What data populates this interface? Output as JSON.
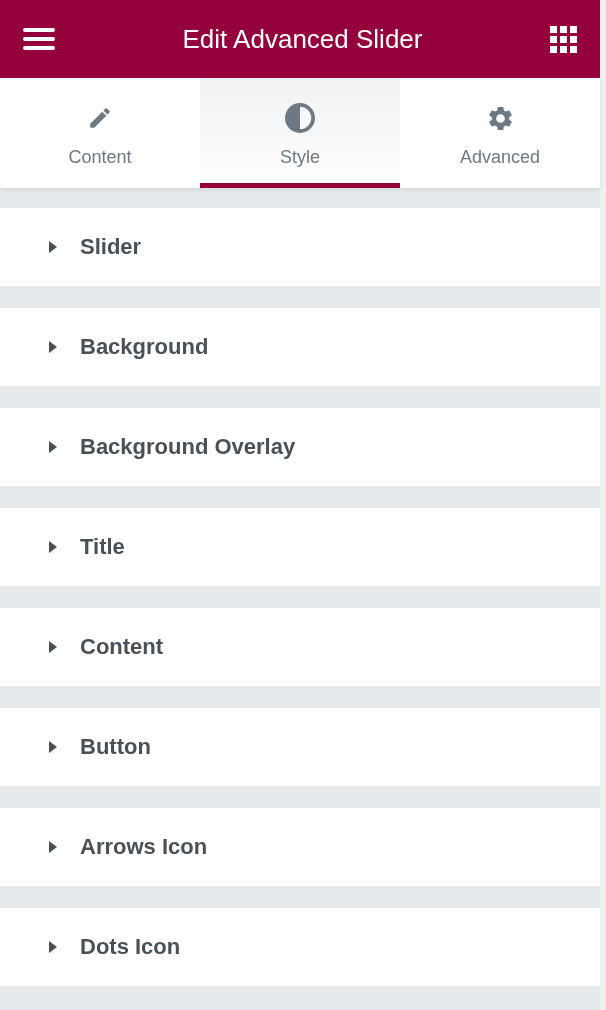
{
  "header": {
    "title": "Edit Advanced Slider"
  },
  "tabs": [
    {
      "label": "Content",
      "kind": "pencil",
      "selected": false
    },
    {
      "label": "Style",
      "kind": "contrast",
      "selected": true
    },
    {
      "label": "Advanced",
      "kind": "gear",
      "selected": false
    }
  ],
  "sections": [
    {
      "title": "Slider",
      "expanded": false
    },
    {
      "title": "Background",
      "expanded": false
    },
    {
      "title": "Background Overlay",
      "expanded": false
    },
    {
      "title": "Title",
      "expanded": false
    },
    {
      "title": "Content",
      "expanded": false
    },
    {
      "title": "Button",
      "expanded": false
    },
    {
      "title": "Arrows Icon",
      "expanded": false
    },
    {
      "title": "Dots Icon",
      "expanded": false
    }
  ]
}
